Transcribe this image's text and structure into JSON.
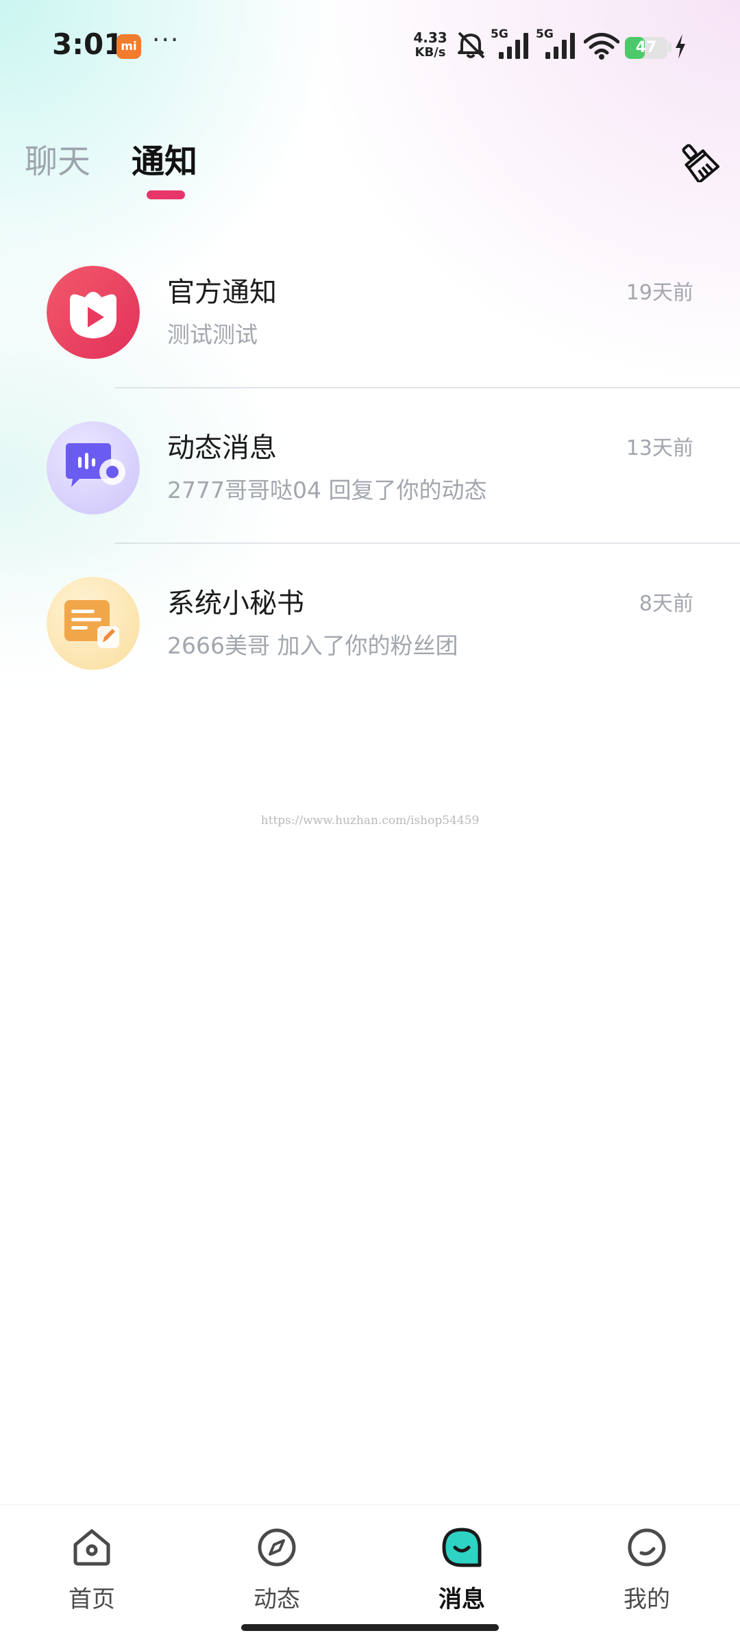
{
  "status_bar": {
    "time": "3:01",
    "brand_badge": "mi",
    "dots": "···",
    "net_speed_value": "4.33",
    "net_speed_unit": "KB/s",
    "sim1_label": "5G",
    "sim2_label": "5G",
    "battery_percent": "47",
    "battery_level": 0.47,
    "battery_color": "#4cc96a"
  },
  "tabs": {
    "chat": "聊天",
    "notify": "通知",
    "active": "notify",
    "accent_color": "#e8366a"
  },
  "notifications": [
    {
      "title": "官方通知",
      "subtitle": "测试测试",
      "time": "19天前",
      "icon": "official-notice-icon"
    },
    {
      "title": "动态消息",
      "subtitle": "2777哥哥哒04 回复了你的动态",
      "time": "13天前",
      "icon": "activity-message-icon"
    },
    {
      "title": "系统小秘书",
      "subtitle": "2666美哥 加入了你的粉丝团",
      "time": "8天前",
      "icon": "system-assistant-icon"
    }
  ],
  "watermark": "https://www.huzhan.com/ishop54459",
  "bottom_nav": {
    "items": [
      {
        "label": "首页",
        "icon": "home-icon"
      },
      {
        "label": "动态",
        "icon": "compass-icon"
      },
      {
        "label": "消息",
        "icon": "message-icon",
        "active": true
      },
      {
        "label": "我的",
        "icon": "profile-icon"
      }
    ],
    "active_color": "#2ed3c4"
  }
}
